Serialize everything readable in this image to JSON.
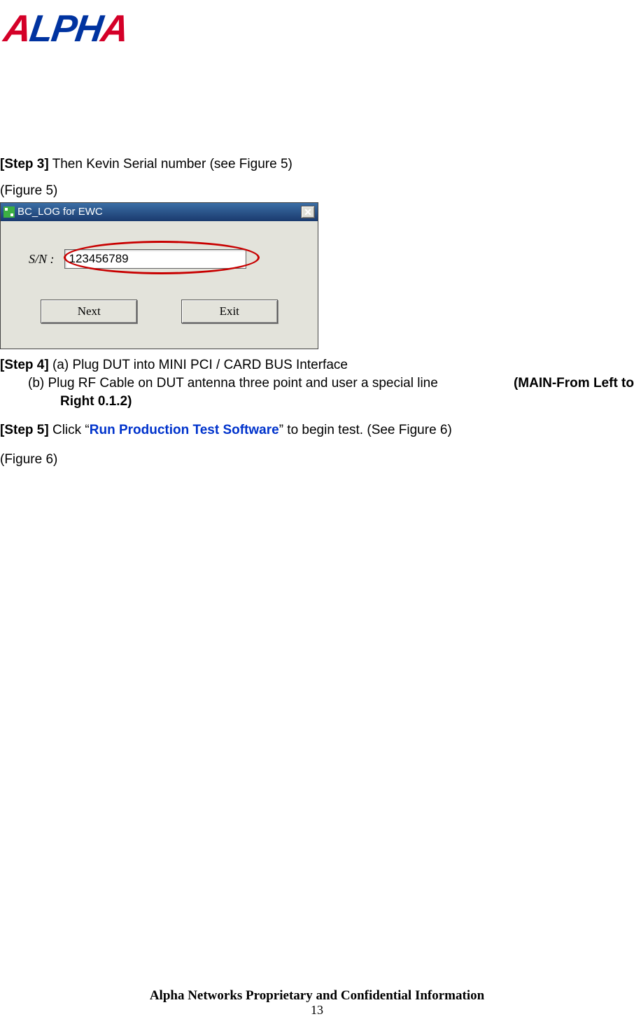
{
  "logo": {
    "text": "ALPHA"
  },
  "step3": {
    "label": "[Step 3]",
    "text": " Then Kevin Serial number (see Figure 5)"
  },
  "figure5_label": "(Figure 5)",
  "dialog": {
    "title": "BC_LOG for EWC",
    "close": "✕",
    "sn_label": "S/N  :",
    "sn_value": "123456789",
    "btn_next": "Next",
    "btn_exit": "Exit"
  },
  "step4": {
    "label": "[Step 4]",
    "line_a": " (a) Plug DUT into MINI PCI / CARD BUS Interface",
    "line_b_pre": "(b) Plug RF Cable on DUT antenna three point and user a special line",
    "line_b_bold": "(MAIN-From Left to Right 0.1.2)"
  },
  "step5": {
    "label": "[Step 5]",
    "pre": " Click “",
    "link": "Run Production Test Software",
    "post": "” to begin test. (See Figure 6)"
  },
  "figure6_label": "(Figure 6)",
  "footer": "Alpha Networks Proprietary and Confidential Information",
  "page_number": "13"
}
